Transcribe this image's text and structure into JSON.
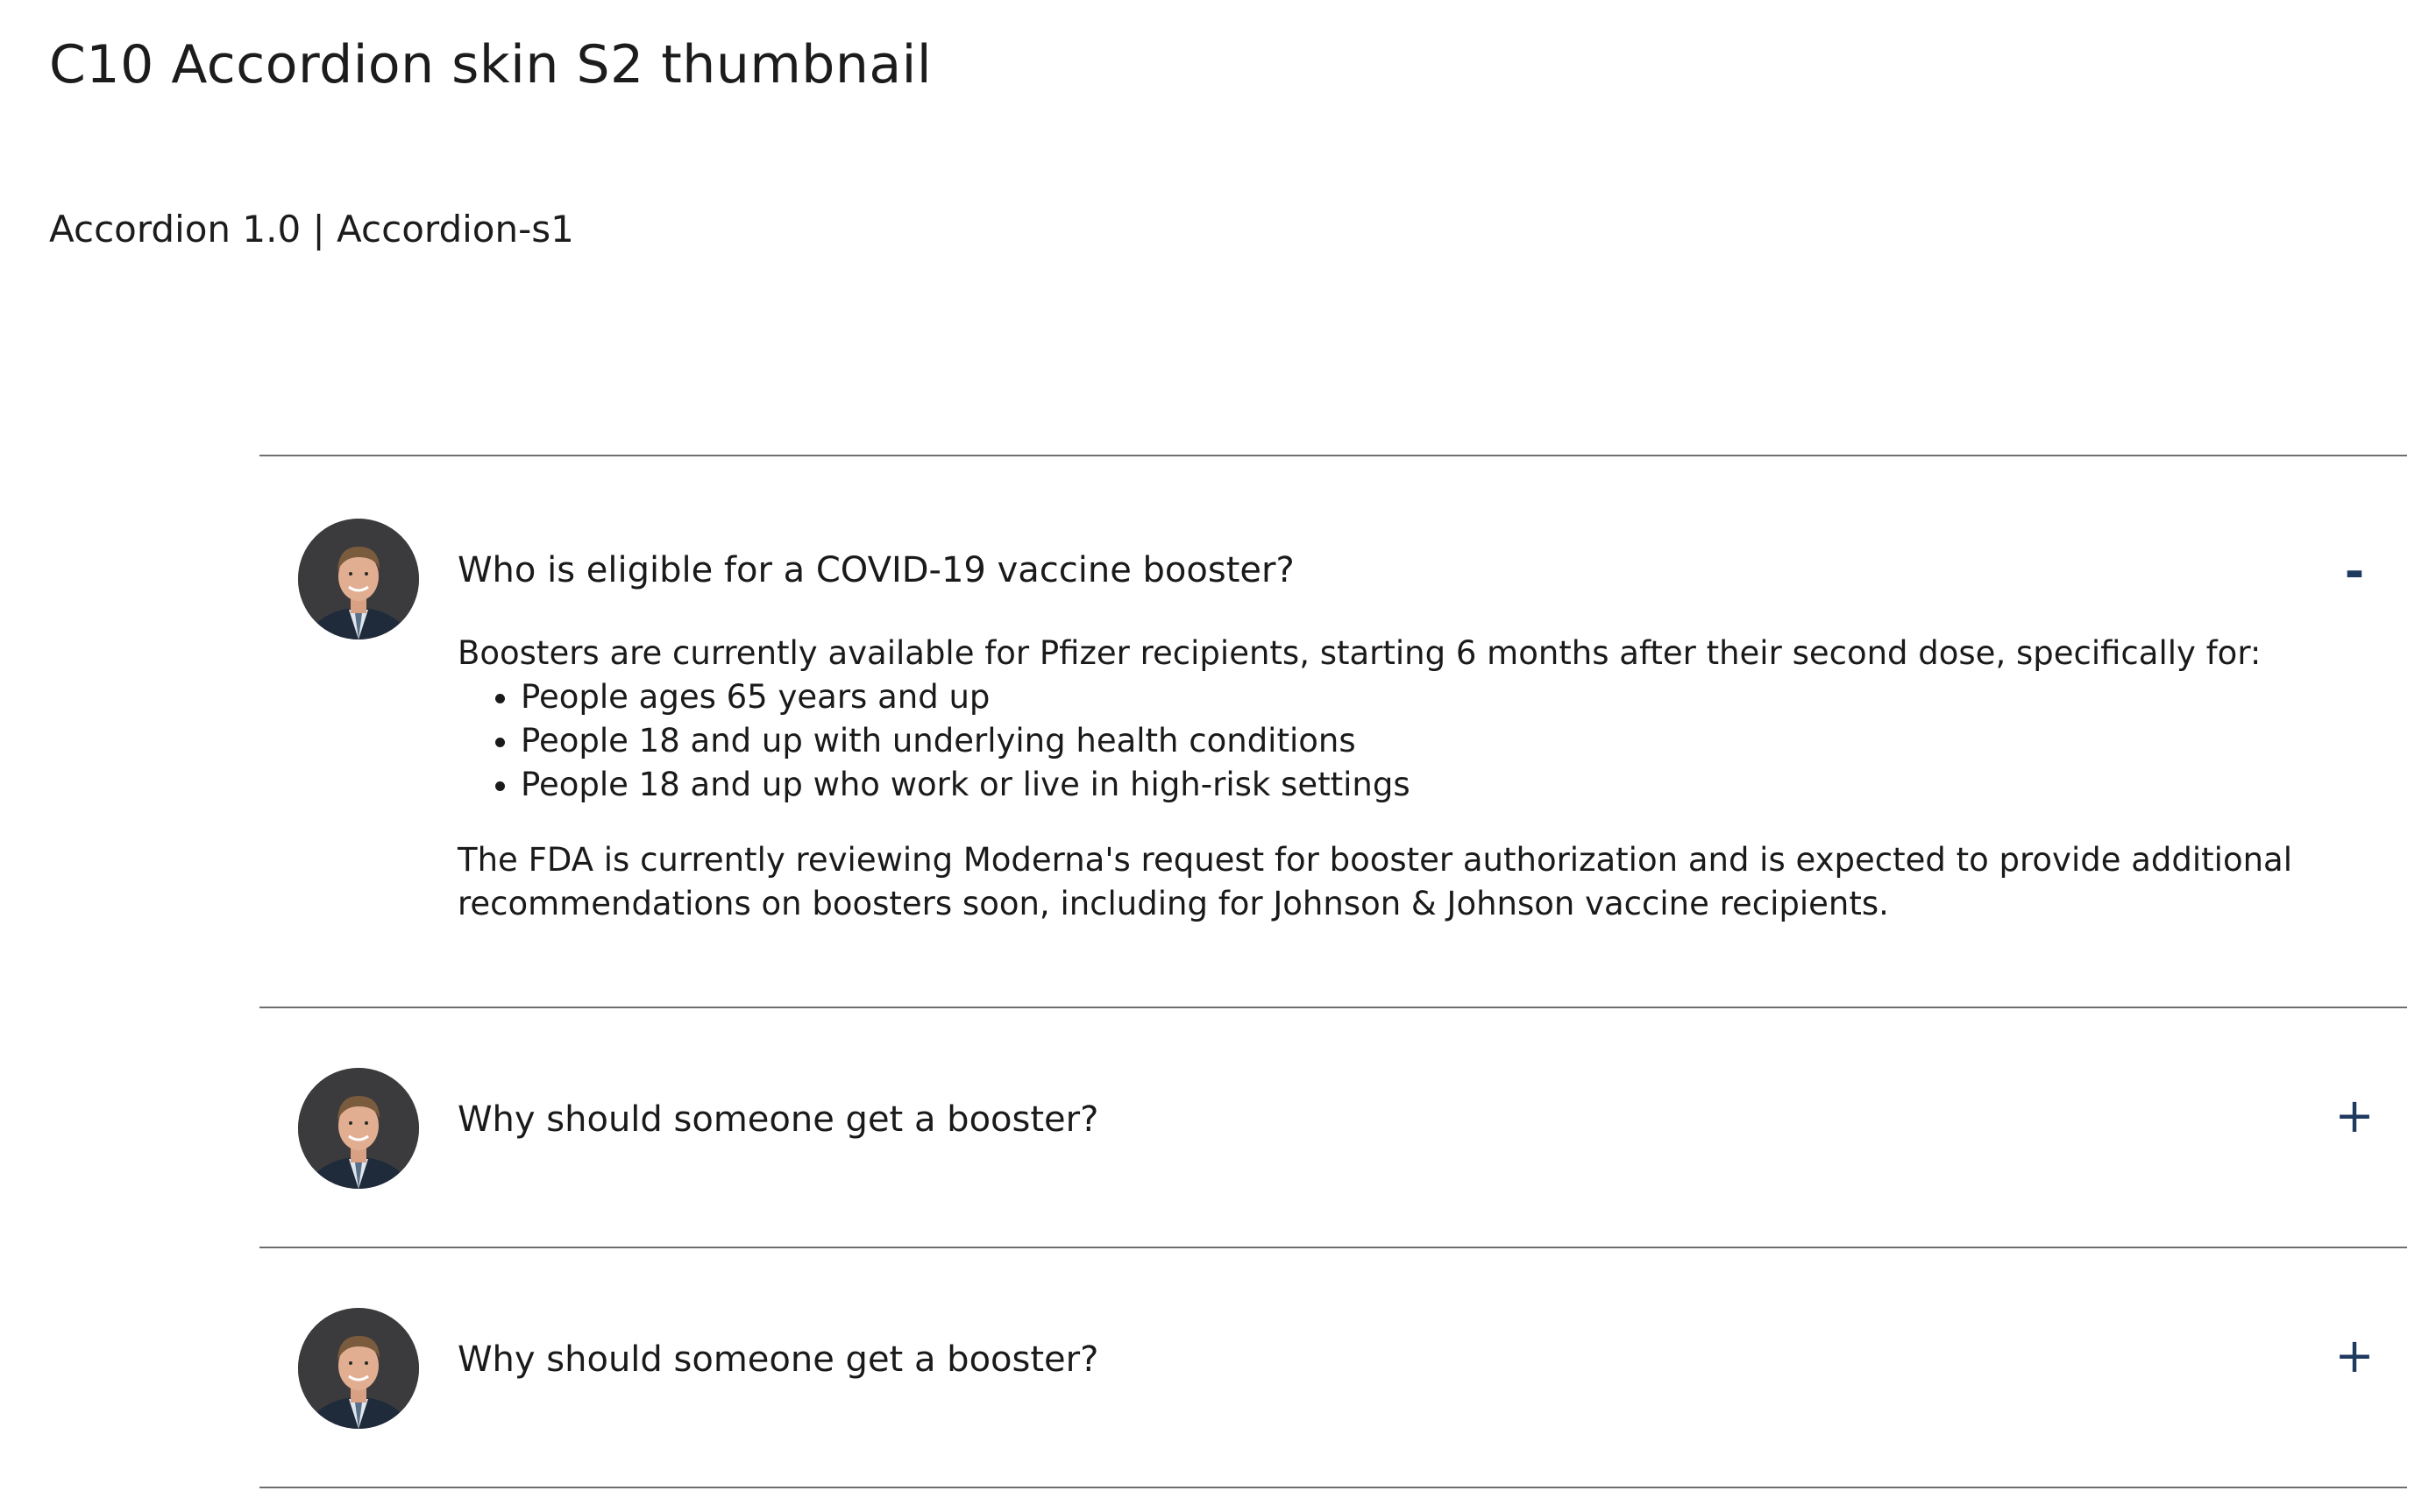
{
  "page": {
    "title": "C10 Accordion skin S2 thumbnail",
    "subtitle": "Accordion 1.0 | Accordion-s1"
  },
  "colors": {
    "divider": "#6e6e6e",
    "toggle_icon": "#1f3a5f",
    "text": "#1a1a1a"
  },
  "accordion": {
    "items": [
      {
        "question": "Who is eligible for a COVID-19 vaccine booster?",
        "state": "expanded",
        "toggle_icon": "minus-icon",
        "toggle_symbol": "-",
        "avatar": "person-avatar",
        "answer": {
          "intro": "Boosters are currently available for Pfizer recipients, starting 6 months after their second dose, specifically for:",
          "bullets": [
            "People ages 65 years and up",
            "People 18 and up with underlying health conditions",
            "People 18 and up who work or live in high-risk settings"
          ],
          "outro": "The FDA is currently reviewing Moderna's request for booster authorization and is expected to provide additional recommendations on boosters soon, including for Johnson & Johnson vaccine recipients."
        }
      },
      {
        "question": "Why should someone get a booster?",
        "state": "collapsed",
        "toggle_icon": "plus-icon",
        "toggle_symbol": "+",
        "avatar": "person-avatar"
      },
      {
        "question": "Why should someone get a booster?",
        "state": "collapsed",
        "toggle_icon": "plus-icon",
        "toggle_symbol": "+",
        "avatar": "person-avatar"
      }
    ]
  }
}
